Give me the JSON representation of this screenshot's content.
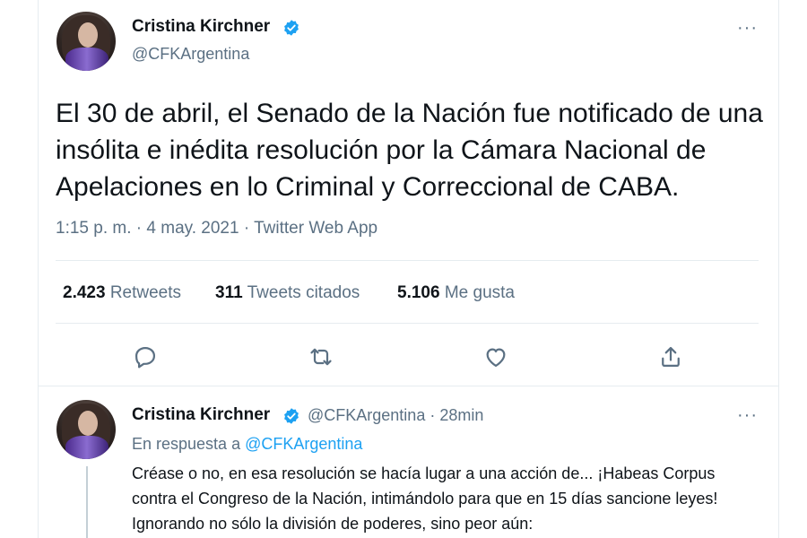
{
  "main_tweet": {
    "author_name": "Cristina Kirchner",
    "author_handle": "@CFKArgentina",
    "text": "El 30 de abril, el Senado de la Nación fue notificado de una insólita e inédita resolución por la Cámara Nacional de Apelaciones en lo Criminal y Correccional de CABA.",
    "time": "1:15 p. m.",
    "separator": "·",
    "date": "4 may. 2021",
    "source": "Twitter Web App",
    "more": "···",
    "stats": {
      "retweets_count": "2.423",
      "retweets_label": "Retweets",
      "quotes_count": "311",
      "quotes_label": "Tweets citados",
      "likes_count": "5.106",
      "likes_label": "Me gusta"
    }
  },
  "actions": {
    "reply_icon": "reply-icon",
    "retweet_icon": "retweet-icon",
    "like_icon": "heart-icon",
    "share_icon": "share-icon"
  },
  "reply_tweet": {
    "author_name": "Cristina Kirchner",
    "author_handle": "@CFKArgentina",
    "separator": "·",
    "time_ago": "28min",
    "more": "···",
    "in_reply_prefix": "En respuesta a",
    "in_reply_handle": "@CFKArgentina",
    "text": "Créase o no, en esa resolución se hacía lugar a una acción de... ¡Habeas Corpus contra el Congreso de la Nación, intimándolo para que en 15 días sancione leyes! Ignorando no sólo la división de poderes, sino peor aún:"
  },
  "colors": {
    "accent": "#1da1f2",
    "secondary_text": "#5b7083",
    "divider": "#e6ecf0"
  }
}
